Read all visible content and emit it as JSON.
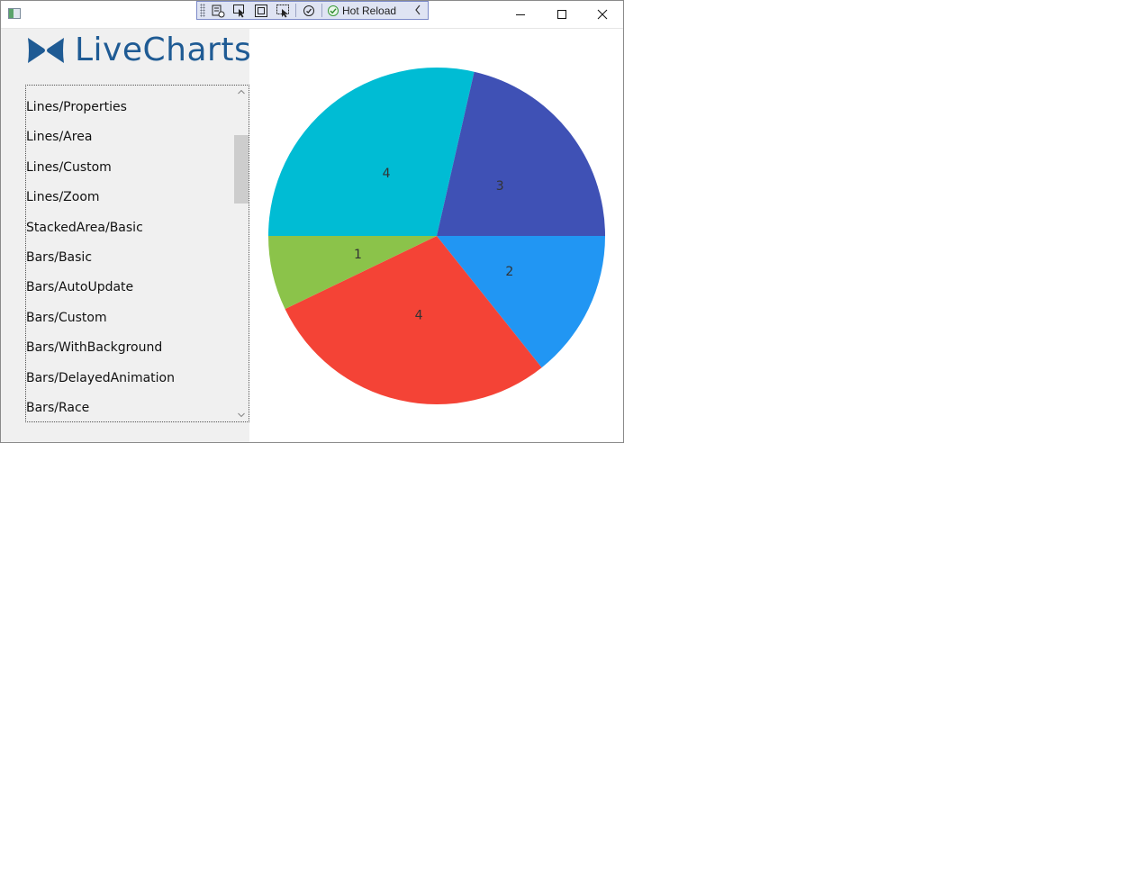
{
  "devtools": {
    "hot_reload_label": "Hot Reload"
  },
  "logo": {
    "text": "LiveCharts",
    "color": "#1f5b94"
  },
  "sidebar": {
    "items": [
      {
        "label": "Lines/Properties"
      },
      {
        "label": "Lines/Area"
      },
      {
        "label": "Lines/Custom"
      },
      {
        "label": "Lines/Zoom"
      },
      {
        "label": "StackedArea/Basic"
      },
      {
        "label": "Bars/Basic"
      },
      {
        "label": "Bars/AutoUpdate"
      },
      {
        "label": "Bars/Custom"
      },
      {
        "label": "Bars/WithBackground"
      },
      {
        "label": "Bars/DelayedAnimation"
      },
      {
        "label": "Bars/Race"
      }
    ]
  },
  "icons": {
    "app": "app-window-icon",
    "minimize": "minimize-icon",
    "maximize": "maximize-icon",
    "close": "close-icon",
    "hot_reload_status": "check-circle-icon"
  },
  "chart_data": {
    "type": "pie",
    "slices": [
      {
        "value": 2,
        "label": "2",
        "color": "#2196f3"
      },
      {
        "value": 4,
        "label": "4",
        "color": "#f44336"
      },
      {
        "value": 1,
        "label": "1",
        "color": "#8bc34a"
      },
      {
        "value": 4,
        "label": "4",
        "color": "#00bcd4"
      },
      {
        "value": 3,
        "label": "3",
        "color": "#3f51b5"
      }
    ]
  }
}
